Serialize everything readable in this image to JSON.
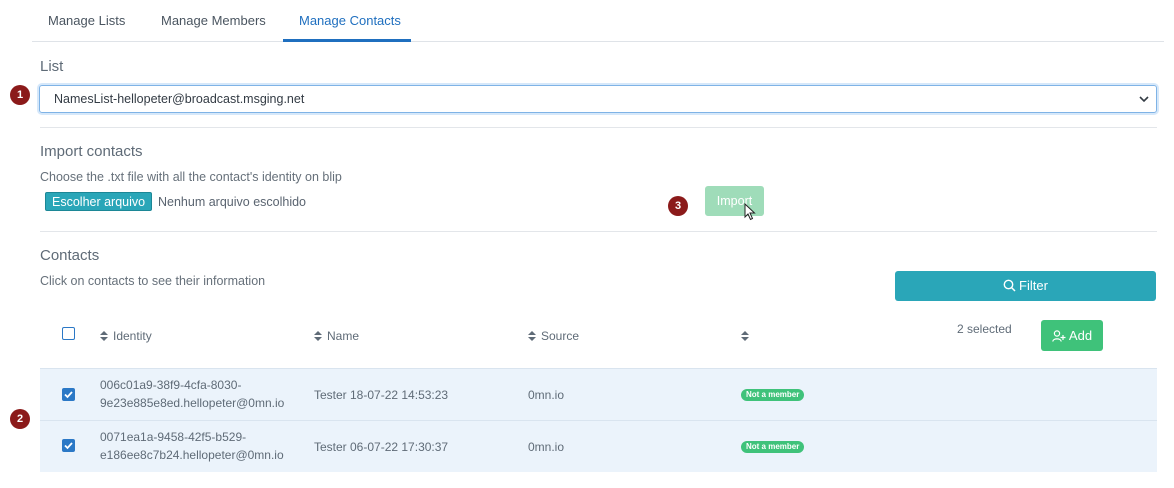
{
  "tabs": [
    {
      "label": "Manage Lists"
    },
    {
      "label": "Manage Members"
    },
    {
      "label": "Manage Contacts"
    }
  ],
  "list_section": {
    "title": "List",
    "selected_value": "NamesList-hellopeter@broadcast.msging.net"
  },
  "import_section": {
    "title": "Import contacts",
    "hint": "Choose the .txt file with all the contact's identity on blip",
    "file_button_label": "Escolher arquivo",
    "file_status": "Nenhum arquivo escolhido",
    "import_label": "Import"
  },
  "contacts_section": {
    "title": "Contacts",
    "hint": "Click on contacts to see their information",
    "filter_label": "Filter",
    "columns": {
      "identity": "Identity",
      "name": "Name",
      "source": "Source"
    },
    "selected_count": "2 selected",
    "add_label": "Add",
    "rows": [
      {
        "identity_line1": "006c01a9-38f9-4cfa-8030-",
        "identity_line2": "9e23e885e8ed.hellopeter@0mn.io",
        "name": "Tester 18-07-22 14:53:23",
        "source": "0mn.io",
        "status": "Not a member",
        "checked": true
      },
      {
        "identity_line1": "0071ea1a-9458-42f5-b529-",
        "identity_line2": "e186ee8c7b24.hellopeter@0mn.io",
        "name": "Tester 06-07-22 17:30:37",
        "source": "0mn.io",
        "status": "Not a member",
        "checked": true
      }
    ]
  },
  "annotations": [
    "1",
    "2",
    "3"
  ],
  "colors": {
    "primary_blue": "#1f6fbf",
    "teal": "#2aa6b8",
    "green": "#3fc27a",
    "import_disabled": "#9fdcb9",
    "annotation_red": "#8b1a1a",
    "row_highlight": "#ebf3fb"
  },
  "icons": {
    "select_chevron": "chevron-down-icon",
    "filter": "search-icon",
    "add": "add-user-icon",
    "sort": "sort-icon",
    "cursor": "mouse-pointer-icon"
  }
}
